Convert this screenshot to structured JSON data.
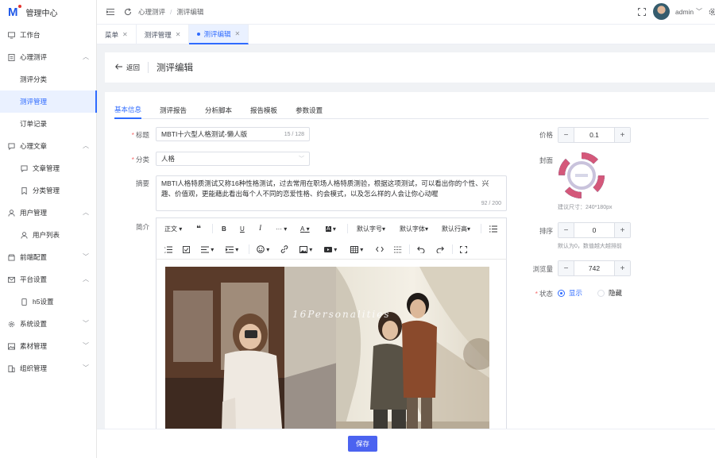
{
  "app": {
    "logo_letter": "M",
    "title": "管理中心"
  },
  "sidebar": {
    "items": [
      {
        "label": "工作台",
        "icon": "monitor-icon"
      },
      {
        "label": "心理测评",
        "icon": "document-icon",
        "expanded": true
      },
      {
        "label": "测评分类"
      },
      {
        "label": "测评管理",
        "active": true
      },
      {
        "label": "订单记录"
      },
      {
        "label": "心理文章",
        "icon": "chat-icon",
        "expanded": true
      },
      {
        "label": "文章管理",
        "icon": "chat-icon"
      },
      {
        "label": "分类管理",
        "icon": "bookmark-icon"
      },
      {
        "label": "用户管理",
        "icon": "user-icon",
        "expanded": true
      },
      {
        "label": "用户列表",
        "icon": "user-icon"
      },
      {
        "label": "前端配置",
        "icon": "shop-icon"
      },
      {
        "label": "平台设置",
        "icon": "mail-icon",
        "expanded": true
      },
      {
        "label": "h5设置",
        "icon": "mobile-icon"
      },
      {
        "label": "系统设置",
        "icon": "gear-icon"
      },
      {
        "label": "素材管理",
        "icon": "image-icon"
      },
      {
        "label": "组织管理",
        "icon": "building-icon"
      }
    ]
  },
  "topbar": {
    "breadcrumb": [
      "心理测评",
      "测评编辑"
    ],
    "username": "admin"
  },
  "tabs": [
    {
      "label": "菜单"
    },
    {
      "label": "测评管理"
    },
    {
      "label": "测评编辑",
      "active": true
    }
  ],
  "page": {
    "back_label": "返回",
    "title": "测评编辑"
  },
  "form_tabs": [
    "基本信息",
    "测评报告",
    "分析脚本",
    "报告模板",
    "参数设置"
  ],
  "form": {
    "title_label": "标题",
    "title_value": "MBTI十六型人格测试-懒人版",
    "title_count": "15 / 128",
    "category_label": "分类",
    "category_value": "人格",
    "summary_label": "摘要",
    "summary_value": "MBTI人格特质测试又称16种性格测试，过去常用在职场人格特质测验，根据这项测试，可以看出你的个性、兴趣、价值观，更能藉此看出每个人不同的恋爱性格、约会模式，以及怎么样的人会让你心动喔",
    "summary_count": "92 / 200",
    "intro_label": "简介",
    "photo_text": "16Personalities"
  },
  "toolbar": {
    "row1": [
      "正文",
      "默认字号",
      "默认字体",
      "默认行高"
    ],
    "tools": [
      "quote-icon",
      "bold-icon",
      "underline-icon",
      "italic-icon",
      "more-icon",
      "font-color-icon",
      "bg-color-icon",
      "list-icon",
      "ordered-list-icon",
      "todo-icon",
      "align-icon",
      "indent-icon",
      "emoji-icon",
      "link-icon",
      "insert-image-icon",
      "video-icon",
      "table-icon",
      "code-icon",
      "divider-icon",
      "undo-icon",
      "redo-icon",
      "fullscreen-icon"
    ],
    "bold": "B",
    "underline": "U",
    "italic": "I",
    "font_color": "A",
    "bg_color": "A"
  },
  "right": {
    "price_label": "价格",
    "price_value": "0.1",
    "cover_label": "封面",
    "cover_hint": "建议尺寸：240*180px",
    "sort_label": "排序",
    "sort_value": "0",
    "sort_hint": "默认为0，数值越大越排前",
    "views_label": "浏览量",
    "views_value": "742",
    "status_label": "状态",
    "status_show": "显示",
    "status_hide": "隐藏"
  },
  "footer": {
    "save_label": "保存"
  },
  "colors": {
    "primary": "#2f6bff",
    "required": "#f56c6c",
    "save": "#4b63f0"
  }
}
